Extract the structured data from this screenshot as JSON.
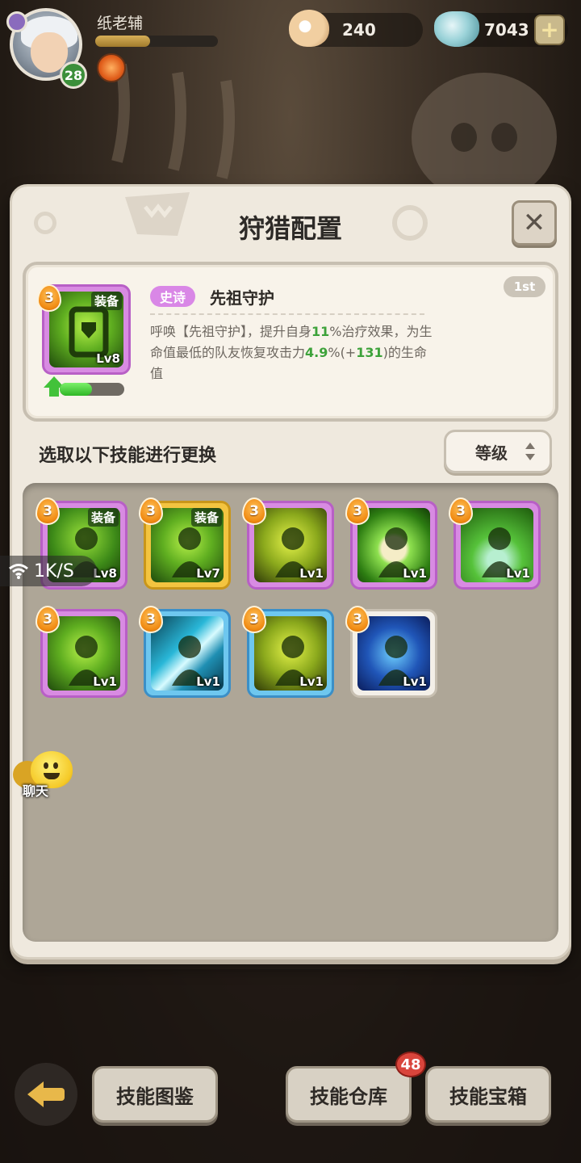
{
  "player": {
    "name": "纸老辅",
    "level": "28",
    "xp_fraction": 0.45
  },
  "resources": {
    "pearls": "240",
    "gems": "7043",
    "add_label": "+"
  },
  "panel": {
    "title": "狩猎配置",
    "close_label": "✕"
  },
  "featured_skill": {
    "badge": "3",
    "equip_tag": "装备",
    "level": "Lv8",
    "rarity": "史诗",
    "name": "先祖守护",
    "rank": "1st",
    "progress_fraction": 0.5,
    "desc": {
      "p1": "呼唤【先祖守护】，提升自身",
      "v1": "11",
      "p2": "%治疗效果，为生命值最低的队友恢复攻击力",
      "v2": "4.9",
      "p3": "%(+",
      "v3": "131",
      "p4": ")的生命值"
    }
  },
  "section": {
    "label": "选取以下技能进行更换",
    "sort_label": "等级"
  },
  "skills": [
    {
      "badge": "3",
      "level": "Lv8",
      "equip": "装备",
      "frame": "purple",
      "art": "dgreen",
      "icon": "warrior-skill-icon"
    },
    {
      "badge": "3",
      "level": "Lv7",
      "equip": "装备",
      "frame": "gold",
      "art": "green",
      "icon": "heal-figure-icon"
    },
    {
      "badge": "3",
      "level": "Lv1",
      "equip": "",
      "frame": "purple",
      "art": "yellow",
      "icon": "shadow-figure-icon"
    },
    {
      "badge": "3",
      "level": "Lv1",
      "equip": "",
      "frame": "purple",
      "art": "swirl",
      "icon": "rune-swirl-icon"
    },
    {
      "badge": "3",
      "level": "Lv1",
      "equip": "",
      "frame": "purple",
      "art": "teal",
      "icon": "healing-rain-icon"
    },
    {
      "badge": "3",
      "level": "Lv1",
      "equip": "",
      "frame": "purple",
      "art": "green",
      "icon": "medical-cross-icon"
    },
    {
      "badge": "3",
      "level": "Lv1",
      "equip": "",
      "frame": "blue",
      "art": "cyan",
      "icon": "slash-icon"
    },
    {
      "badge": "3",
      "level": "Lv1",
      "equip": "",
      "frame": "blue",
      "art": "yellow",
      "icon": "totem-heal-icon"
    },
    {
      "badge": "3",
      "level": "Lv1",
      "equip": "",
      "frame": "white",
      "art": "elec",
      "icon": "electric-figure-icon"
    }
  ],
  "overlay": {
    "net_speed": "1K/S",
    "chat_label": "聊天"
  },
  "bottom": {
    "codex_label": "技能图鉴",
    "storage_label": "技能仓库",
    "storage_badge": "48",
    "chest_label": "技能宝箱"
  }
}
